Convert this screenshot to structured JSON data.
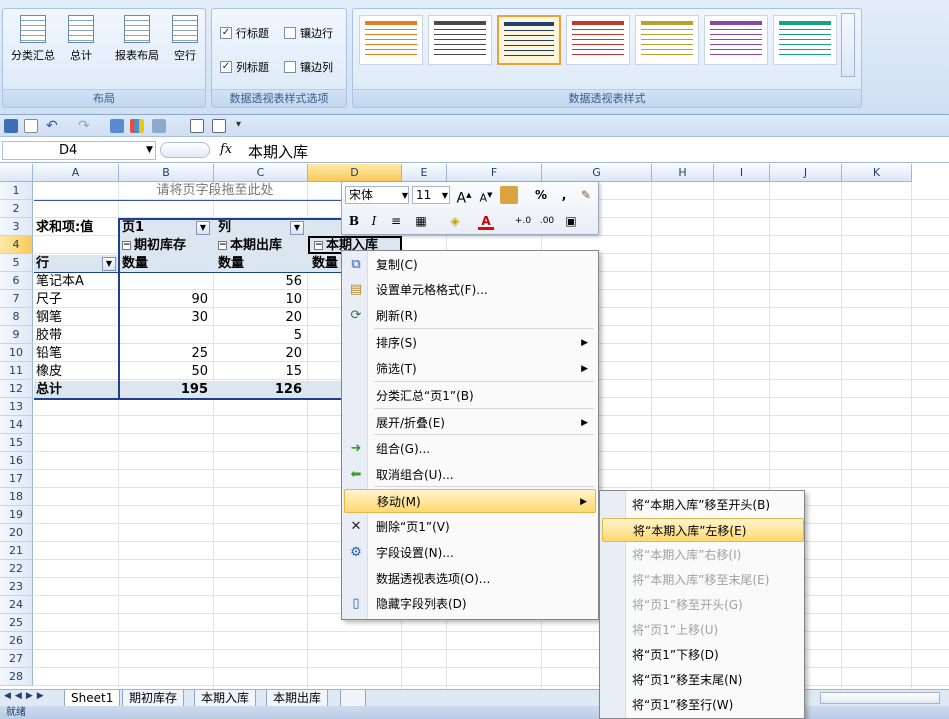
{
  "ribbon": {
    "layout_group": {
      "label": "布局",
      "buttons": [
        "分类汇总",
        "总计",
        "报表布局",
        "空行"
      ]
    },
    "style_options_group": {
      "label": "数据透视表样式选项",
      "checkboxes": [
        {
          "label": "行标题",
          "checked": true
        },
        {
          "label": "镶边行",
          "checked": false
        },
        {
          "label": "列标题",
          "checked": true
        },
        {
          "label": "镶边列",
          "checked": false
        }
      ]
    },
    "styles_group": {
      "label": "数据透视表样式",
      "swatch_colors": [
        "#e67e22",
        "#4a4a4a",
        "#1f3f7a",
        "#c0392b",
        "#b7a32c",
        "#8e44ad",
        "#16a085"
      ]
    }
  },
  "formula_bar": {
    "name_box": "D4",
    "fx": "fx",
    "content": "本期入库"
  },
  "columns": [
    "A",
    "B",
    "C",
    "D",
    "E",
    "F",
    "G",
    "H",
    "I",
    "J",
    "K"
  ],
  "rows": [
    "1",
    "2",
    "3",
    "4",
    "5",
    "6",
    "7",
    "8",
    "9",
    "10",
    "11",
    "12",
    "13",
    "14",
    "15",
    "16",
    "17",
    "18",
    "19",
    "20",
    "21",
    "22",
    "23",
    "24",
    "25",
    "26",
    "27",
    "28"
  ],
  "pivot": {
    "page_drop_hint": "请将页字段拖至此处",
    "sum_label": "求和项:值",
    "page_field": "页1",
    "column_field": "列",
    "row_field": "行",
    "col_headers": [
      "期初库存",
      "本期出库",
      "本期入库"
    ],
    "sub_header": "数量",
    "rows": [
      {
        "name": "笔记本A",
        "b": "",
        "c": "56"
      },
      {
        "name": "尺子",
        "b": "90",
        "c": "10"
      },
      {
        "name": "钢笔",
        "b": "30",
        "c": "20"
      },
      {
        "name": "胶带",
        "b": "",
        "c": "5"
      },
      {
        "name": "铅笔",
        "b": "25",
        "c": "20"
      },
      {
        "name": "橡皮",
        "b": "50",
        "c": "15"
      }
    ],
    "total_label": "总计",
    "total_b": "195",
    "total_c": "126"
  },
  "mini_toolbar": {
    "font": "宋体",
    "size": "11",
    "bold": "B",
    "italic": "I",
    "percent": "%",
    "comma": ","
  },
  "context_menu": {
    "items": [
      {
        "label": "复制(C)",
        "icon": "copy-icon"
      },
      {
        "label": "设置单元格格式(F)...",
        "icon": "format-cells-icon"
      },
      {
        "label": "刷新(R)",
        "icon": "refresh-icon"
      },
      {
        "label": "排序(S)",
        "submenu": true
      },
      {
        "label": "筛选(T)",
        "submenu": true
      },
      {
        "label": "分类汇总“页1”(B)"
      },
      {
        "label": "展开/折叠(E)",
        "submenu": true
      },
      {
        "label": "组合(G)...",
        "icon": "group-icon"
      },
      {
        "label": "取消组合(U)...",
        "icon": "ungroup-icon"
      },
      {
        "label": "移动(M)",
        "submenu": true,
        "highlighted": true
      },
      {
        "label": "删除“页1”(V)",
        "icon": "delete-icon"
      },
      {
        "label": "字段设置(N)...",
        "icon": "field-settings-icon"
      },
      {
        "label": "数据透视表选项(O)..."
      },
      {
        "label": "隐藏字段列表(D)",
        "icon": "field-list-icon"
      }
    ]
  },
  "move_submenu": {
    "items": [
      {
        "label": "将“本期入库”移至开头(B)",
        "enabled": true
      },
      {
        "label": "将“本期入库”左移(E)",
        "enabled": true,
        "highlighted": true
      },
      {
        "label": "将“本期入库”右移(I)",
        "enabled": false
      },
      {
        "label": "将“本期入库”移至末尾(E)",
        "enabled": false
      },
      {
        "label": "将“页1”移至开头(G)",
        "enabled": false
      },
      {
        "label": "将“页1”上移(U)",
        "enabled": false
      },
      {
        "label": "将“页1”下移(D)",
        "enabled": true
      },
      {
        "label": "将“页1”移至末尾(N)",
        "enabled": true
      },
      {
        "label": "将“页1”移至行(W)",
        "enabled": true
      }
    ]
  },
  "sheet_tabs": [
    "Sheet1",
    "期初库存",
    "本期入库",
    "本期出库"
  ],
  "status": "就绪"
}
